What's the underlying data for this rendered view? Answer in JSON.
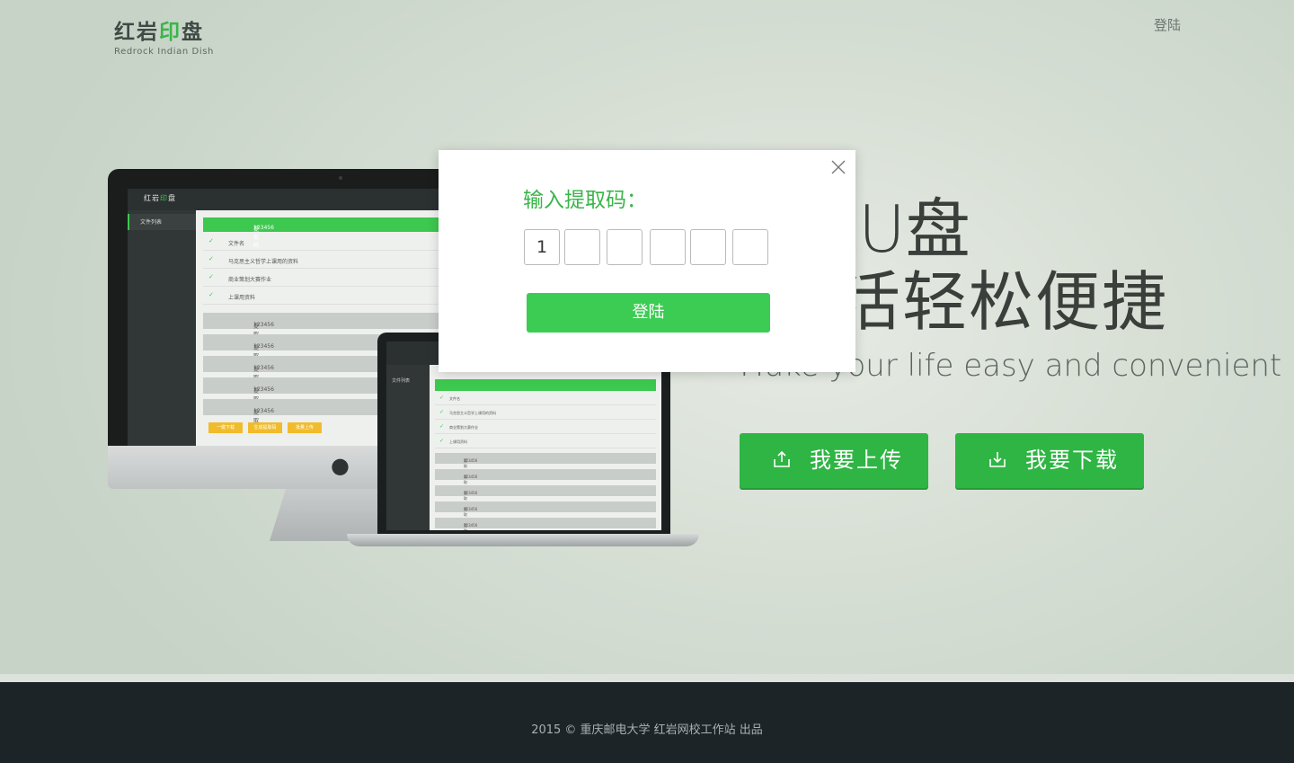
{
  "header": {
    "logo_part1": "红岩",
    "logo_accent": "印",
    "logo_part2": "盘",
    "logo_subtitle": "Redrock Indian Dish",
    "login_link": "登陆"
  },
  "hero": {
    "title_line1": "U盘",
    "title_line2": "活轻松便捷",
    "subtitle": "Make your life easy and convenient",
    "upload_button": "我要上传",
    "download_button": "我要下载"
  },
  "mockup": {
    "app_logo_part1": "红岩",
    "app_logo_accent": "印",
    "app_logo_part2": "盘",
    "sidebar_item": "文件列表",
    "code_label": "提取码",
    "code_value": "123456",
    "file_header": "文件名",
    "files": [
      "马克思主义哲学上课用的资料",
      "商业策划大赛作业",
      "上课用资料"
    ],
    "buttons": [
      "一键下载",
      "生成提取码",
      "批量上传"
    ]
  },
  "modal": {
    "title": "输入提取码：",
    "code_digits": [
      "1",
      "",
      "",
      "",
      "",
      ""
    ],
    "login_button": "登陆"
  },
  "footer": {
    "text": "2015 © 重庆邮电大学 红岩网校工作站 出品"
  },
  "colors": {
    "accent": "#3ab54a",
    "button_green": "#2fb544",
    "footer_bg": "#1d2428"
  }
}
